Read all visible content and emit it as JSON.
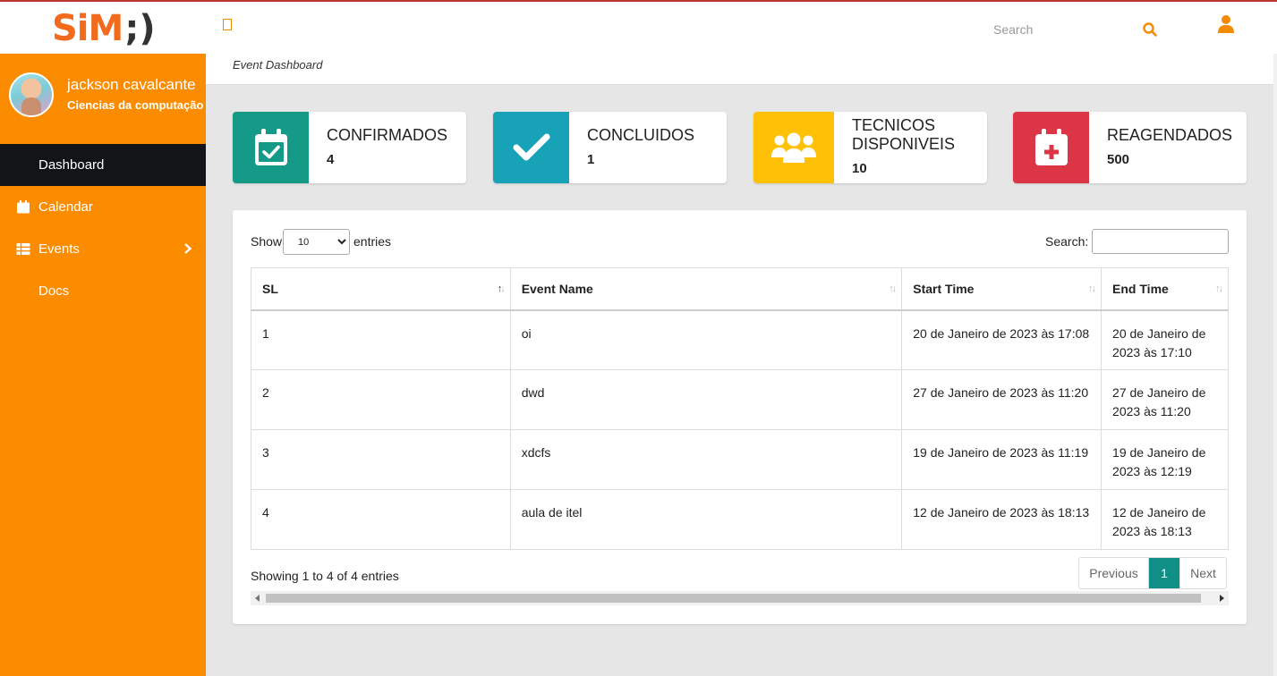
{
  "header": {
    "logo_text": "SiM",
    "logo_smile": ";)",
    "search_placeholder": "Search"
  },
  "sidebar": {
    "user_name": "jackson cavalcante",
    "user_role": "Ciencias da computação",
    "items": [
      {
        "label": "Dashboard",
        "active": true
      },
      {
        "label": "Calendar"
      },
      {
        "label": "Events"
      },
      {
        "label": "Docs"
      }
    ]
  },
  "breadcrumb": "Event Dashboard",
  "cards": [
    {
      "title": "CONFIRMADOS",
      "value": "4",
      "color": "#149a86",
      "icon": "calendar-check-icon"
    },
    {
      "title": "CONCLUIDOS",
      "value": "1",
      "color": "#17a2b8",
      "icon": "check-icon"
    },
    {
      "title_line1": "TECNICOS",
      "title_line2": "DISPONIVEIS",
      "value": "10",
      "color": "#ffc107",
      "icon": "users-icon"
    },
    {
      "title": "REAGENDADOS",
      "value": "500",
      "color": "#dc3545",
      "icon": "calendar-plus-icon"
    }
  ],
  "table": {
    "show_label": "Show",
    "length_value": "10",
    "entries_label": "entries",
    "search_label": "Search:",
    "columns": [
      "SL",
      "Event Name",
      "Start Time",
      "End Time"
    ],
    "rows": [
      [
        "1",
        "oi",
        "20 de Janeiro de 2023 às 17:08",
        "20 de Janeiro de 2023 às 17:10"
      ],
      [
        "2",
        "dwd",
        "27 de Janeiro de 2023 às 11:20",
        "27 de Janeiro de 2023 às 11:20"
      ],
      [
        "3",
        "xdcfs",
        "19 de Janeiro de 2023 às 11:19",
        "19 de Janeiro de 2023 às 12:19"
      ],
      [
        "4",
        "aula de itel",
        "12 de Janeiro de 2023 às 18:13",
        "12 de Janeiro de 2023 às 18:13"
      ]
    ],
    "info": "Showing 1 to 4 of 4 entries",
    "pagination": {
      "previous": "Previous",
      "current": "1",
      "next": "Next"
    }
  },
  "colors": {
    "accent": "#fb8c00",
    "active_nav": "#121417",
    "page_active": "#0f8f86"
  }
}
